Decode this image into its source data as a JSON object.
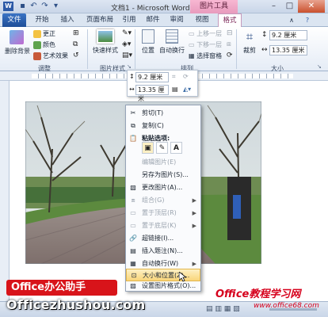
{
  "window": {
    "title": "文档1 - Microsoft Word",
    "context_tab": "图片工具",
    "quick_access": [
      "save-icon",
      "undo-icon",
      "redo-icon",
      "customize-icon"
    ]
  },
  "tabs": [
    "文件",
    "开始",
    "插入",
    "页面布局",
    "引用",
    "邮件",
    "审阅",
    "视图",
    "格式"
  ],
  "ribbon": {
    "adjust": {
      "label": "调整",
      "items": [
        "删除背景",
        "更正",
        "颜色",
        "艺术效果"
      ]
    },
    "styles": {
      "label": "图片样式",
      "quick": "快速样式"
    },
    "arrange": {
      "label": "排列",
      "items": [
        "位置",
        "自动换行",
        "上移一层",
        "下移一层",
        "选择窗格"
      ]
    },
    "size": {
      "label": "大小",
      "crop": "裁剪",
      "height": "9.2 厘米",
      "width": "13.35 厘米"
    }
  },
  "minibar": {
    "height": "9.2 厘米",
    "width": "13.35 厘米"
  },
  "menu": {
    "items": [
      {
        "label": "剪切(T)",
        "enabled": true
      },
      {
        "label": "复制(C)",
        "enabled": true
      },
      {
        "label": "粘贴选项:",
        "enabled": true
      },
      {
        "label": "编辑图片(E)",
        "enabled": false
      },
      {
        "label": "另存为图片(S)...",
        "enabled": true
      },
      {
        "label": "更改图片(A)...",
        "enabled": true
      },
      {
        "label": "组合(G)",
        "enabled": false
      },
      {
        "label": "置于顶层(R)",
        "enabled": false
      },
      {
        "label": "置于底层(K)",
        "enabled": false
      },
      {
        "label": "超链接(I)...",
        "enabled": true
      },
      {
        "label": "插入题注(N)...",
        "enabled": true
      },
      {
        "label": "自动换行(W)",
        "enabled": true
      },
      {
        "label": "大小和位置(Z)...",
        "enabled": true,
        "highlighted": true
      },
      {
        "label": "设置图片格式(O)...",
        "enabled": true
      }
    ]
  },
  "branding": {
    "badge": "Office办公助手",
    "site": "Officezhushou.com",
    "watermark": "Office教程学习网",
    "watermark_url": "www.office68.com"
  }
}
